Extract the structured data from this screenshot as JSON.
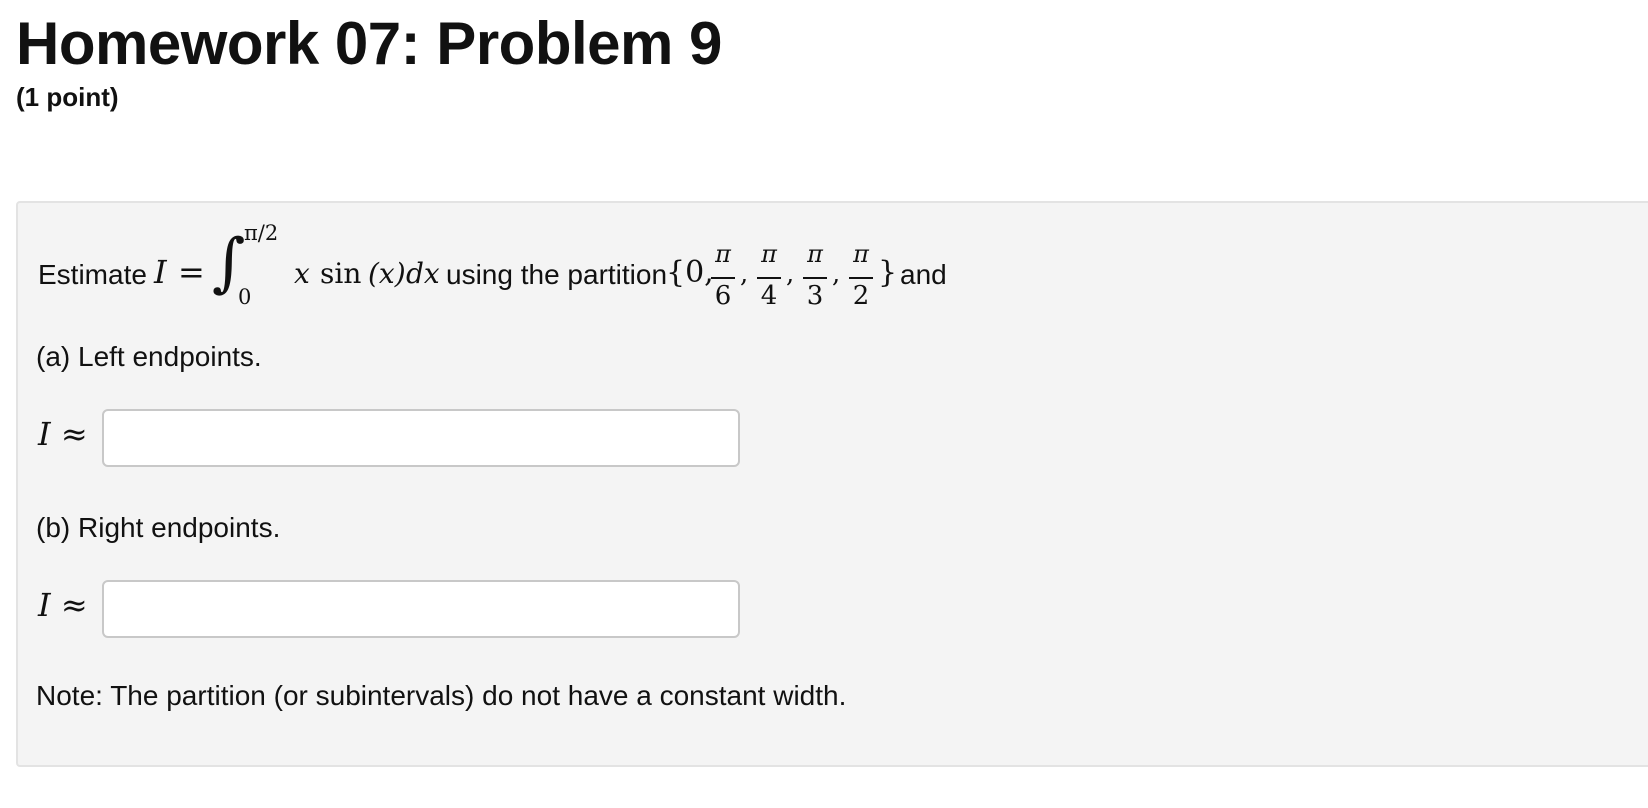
{
  "header": {
    "title": "Homework 07: Problem 9",
    "points": "(1 point)"
  },
  "problem": {
    "stem_prefix": "Estimate",
    "integral_var": "I",
    "equals": "=",
    "integral_sign": "∫",
    "upper_limit": "π/2",
    "lower_limit": "0",
    "integrand_x": "x",
    "integrand_sin": "sin",
    "integrand_arg": "(x)",
    "integrand_dx": "dx",
    "stem_middle": "using the partition",
    "partition_open": "{0,",
    "partition_fractions": [
      {
        "numerator": "π",
        "denominator": "6"
      },
      {
        "numerator": "π",
        "denominator": "4"
      },
      {
        "numerator": "π",
        "denominator": "3"
      },
      {
        "numerator": "π",
        "denominator": "2"
      }
    ],
    "partition_separator": ",",
    "partition_close": "}",
    "stem_suffix": "and",
    "part_a": {
      "label": "(a) Left endpoints.",
      "answer_var": "I",
      "approx_symbol": "≈",
      "answer_value": ""
    },
    "part_b": {
      "label": "(b) Right endpoints.",
      "answer_var": "I",
      "approx_symbol": "≈",
      "answer_value": ""
    },
    "note": "Note: The partition (or subintervals) do not have a constant width."
  }
}
